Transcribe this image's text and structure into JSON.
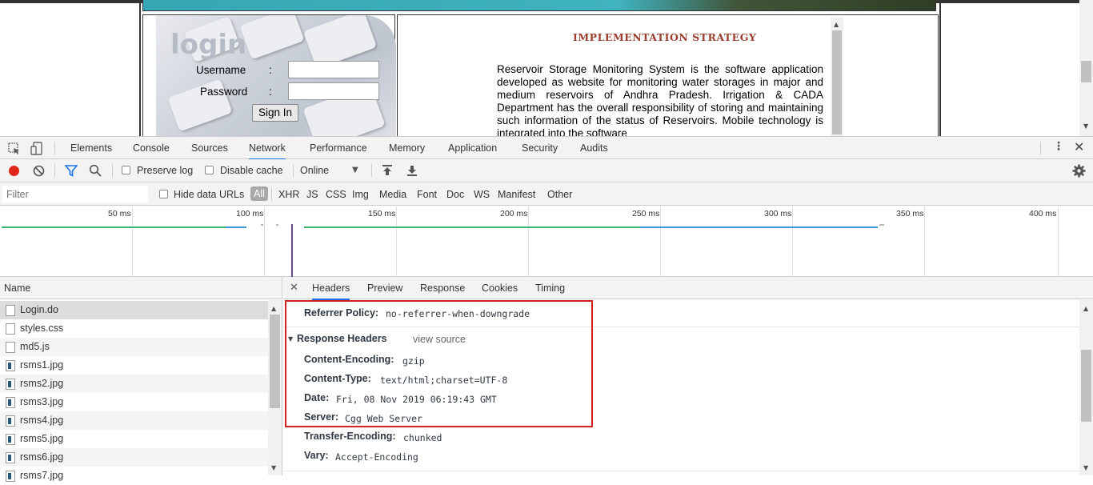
{
  "page": {
    "login_title": "login",
    "username_label": "Username",
    "password_label": "Password",
    "colon": ":",
    "sign_in": "Sign In",
    "impl_title": "IMPLEMENTATION STRATEGY",
    "impl_text": "Reservoir Storage Monitoring System is the software application developed as website for monitoring water storages in major and medium reservoirs of Andhra Pradesh. Irrigation & CADA Department has the overall responsibility of storing and maintaining such information of the status of Reservoirs. Mobile technology is integrated into the software"
  },
  "devtools": {
    "tabs": [
      "Elements",
      "Console",
      "Sources",
      "Network",
      "Performance",
      "Memory",
      "Application",
      "Security",
      "Audits"
    ],
    "active_tab": "Network",
    "toolbar": {
      "preserve_log": "Preserve log",
      "disable_cache": "Disable cache",
      "throttle": "Online"
    },
    "filter": {
      "placeholder": "Filter",
      "hide_data_urls": "Hide data URLs",
      "types": [
        "All",
        "XHR",
        "JS",
        "CSS",
        "Img",
        "Media",
        "Font",
        "Doc",
        "WS",
        "Manifest",
        "Other"
      ]
    },
    "timeline_ticks": [
      "50 ms",
      "100 ms",
      "150 ms",
      "200 ms",
      "250 ms",
      "300 ms",
      "350 ms",
      "400 ms"
    ],
    "name_header": "Name",
    "requests": [
      "Login.do",
      "styles.css",
      "md5.js",
      "rsms1.jpg",
      "rsms2.jpg",
      "rsms3.jpg",
      "rsms4.jpg",
      "rsms5.jpg",
      "rsms6.jpg",
      "rsms7.jpg"
    ],
    "detail_tabs": [
      "Headers",
      "Preview",
      "Response",
      "Cookies",
      "Timing"
    ],
    "referrer_policy_key": "Referrer Policy:",
    "referrer_policy_val": "no-referrer-when-downgrade",
    "response_headers_title": "Response Headers",
    "view_source": "view source",
    "response_headers": [
      {
        "key": "Content-Encoding:",
        "value": "gzip"
      },
      {
        "key": "Content-Type:",
        "value": "text/html;charset=UTF-8"
      },
      {
        "key": "Date:",
        "value": "Fri, 08 Nov 2019 06:19:43 GMT"
      },
      {
        "key": "Server:",
        "value": "Cgg Web Server"
      },
      {
        "key": "Transfer-Encoding:",
        "value": "chunked"
      },
      {
        "key": "Vary:",
        "value": "Accept-Encoding"
      }
    ]
  },
  "colors": {
    "accent": "#1a73e8",
    "record": "#e0251b",
    "highlight_box": "#d32020",
    "impl_title": "#9c3e2e"
  }
}
